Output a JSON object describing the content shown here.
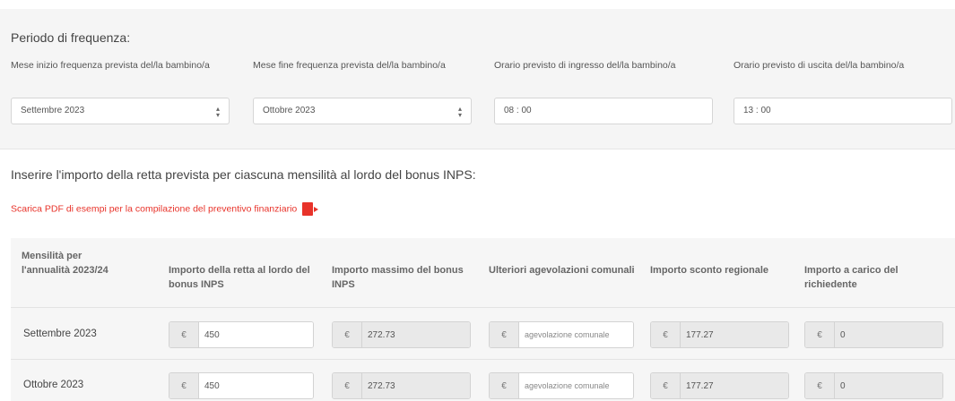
{
  "period": {
    "title": "Periodo di frequenza:",
    "fields": [
      {
        "label": "Mese inizio frequenza prevista del/la bambino/a",
        "value": "Settembre 2023"
      },
      {
        "label": "Mese fine frequenza prevista del/la bambino/a",
        "value": "Ottobre 2023"
      },
      {
        "label": "Orario previsto di ingresso del/la bambino/a",
        "value": "08 : 00"
      },
      {
        "label": "Orario previsto di uscita del/la bambino/a",
        "value": "13 : 00"
      }
    ]
  },
  "fees": {
    "instructions": "Inserire l'importo della retta prevista per ciascuna mensilità al lordo del bonus INPS:",
    "pdf_link": "Scarica PDF di esempi per la compilazione del preventivo finanziario",
    "currency_symbol": "€",
    "headers": [
      "Mensilità per l'annualità 2023/24",
      "Importo della retta al lordo del bonus INPS",
      "Importo massimo del bonus INPS",
      "Ulteriori agevolazioni comunali",
      "Importo sconto regionale",
      "Importo a carico del richiedente"
    ],
    "rows": [
      {
        "month": "Settembre 2023",
        "retta": "450",
        "bonus": "272.73",
        "agevolazioni_placeholder": "agevolazione comunale",
        "sconto": "177.27",
        "carico": "0"
      },
      {
        "month": "Ottobre 2023",
        "retta": "450",
        "bonus": "272.73",
        "agevolazioni_placeholder": "agevolazione comunale",
        "sconto": "177.27",
        "carico": "0"
      }
    ]
  }
}
